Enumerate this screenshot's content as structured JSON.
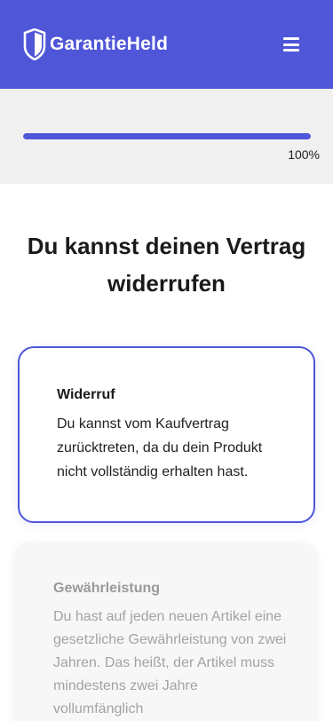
{
  "header": {
    "brand": "GarantieHeld",
    "accent_color": "#4f56d8",
    "logo_icon": "shield-icon",
    "menu_icon": "hamburger-menu-icon"
  },
  "progress": {
    "value_percent": 100,
    "label": "100%"
  },
  "main": {
    "title": "Du kannst deinen Vertrag widerrufen"
  },
  "options": [
    {
      "title": "Widerruf",
      "text": "Du kannst vom Kaufvertrag zurücktreten, da du dein Produkt nicht vollständig erhalten hast.",
      "selected": true
    },
    {
      "title": "Gewährleistung",
      "text": "Du hast auf jeden neuen Artikel eine gesetzliche Gewährleistung von zwei Jahren. Das heißt, der Artikel muss mindestens zwei Jahre vollumfänglich",
      "selected": false
    }
  ]
}
